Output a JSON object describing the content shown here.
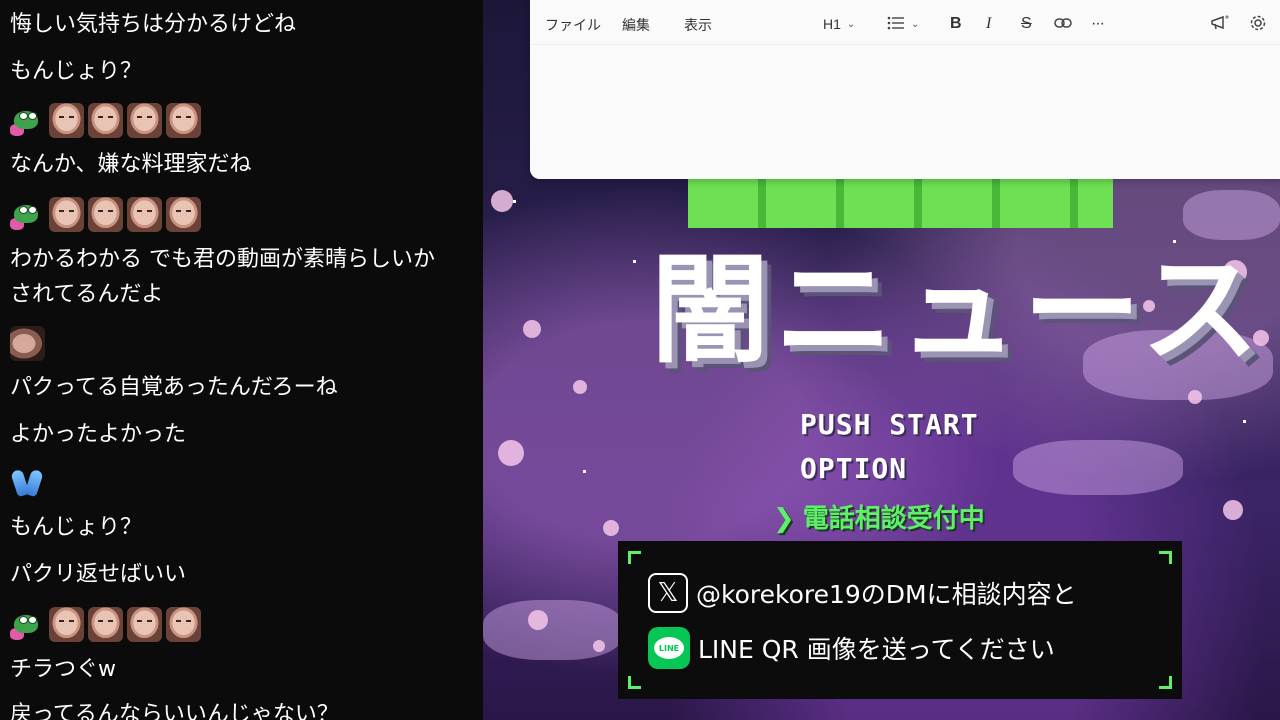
{
  "chat": {
    "messages": [
      {
        "text": "悔しい気持ちは分かるけどね"
      },
      {
        "text": "もんじょり？"
      },
      {
        "text": "なんか、嫌な料理家だね"
      },
      {
        "text": "わかるわかる でも君の動画が素晴らしいか"
      },
      {
        "text": "されてるんだよ"
      },
      {
        "text": "パクってる自覚あったんだろーね"
      },
      {
        "text": "よかったよかった"
      },
      {
        "text": "もんじょり？"
      },
      {
        "text": "パクリ返せばいい"
      },
      {
        "text": "チラつぐw"
      },
      {
        "text": "戻ってるんならいいんじゃない？"
      }
    ],
    "emotes": {
      "frog": "pepe-emote",
      "face": "face-emote",
      "single": "avatar-emote",
      "hands": "raised-hands-emote"
    }
  },
  "stream": {
    "title_kana": "闇ニュース",
    "menu": {
      "push_start": "PUSH START",
      "option": "OPTION",
      "consult": "電話相談受付中",
      "consult_icon": "chevron-right-icon"
    },
    "info": {
      "line1": "@korekore19のDMに相談内容と",
      "line2": "LINE QR 画像を送ってください",
      "x_icon": "𝕏",
      "line_icon_label": "LINE"
    },
    "colors": {
      "accent_green": "#5ff06a",
      "title_green": "#6ee053",
      "sky": "#2a1f4e"
    }
  },
  "editor": {
    "menus": [
      "ファイル",
      "編集",
      "表示"
    ],
    "toolbar": {
      "heading": "H1",
      "bold": "B",
      "italic": "I",
      "strike": "S",
      "more": "···"
    },
    "icons": [
      "list-icon",
      "link-icon",
      "announce-icon",
      "settings-icon"
    ]
  }
}
